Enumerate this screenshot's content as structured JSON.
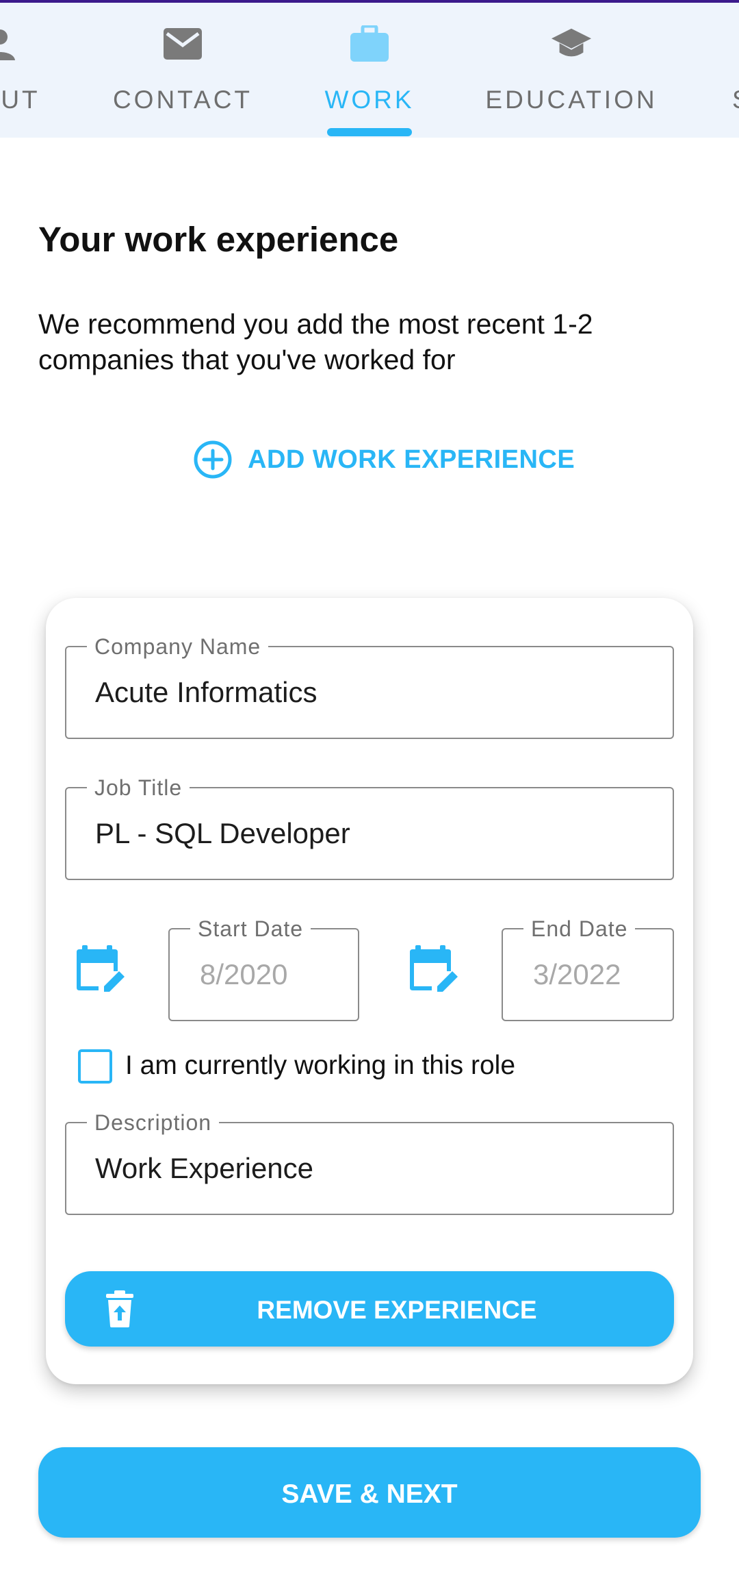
{
  "tabs": [
    {
      "label": "ABOUT",
      "visible_label": "UT",
      "icon": "person-icon",
      "active": false
    },
    {
      "label": "CONTACT",
      "icon": "envelope-icon",
      "active": false
    },
    {
      "label": "WORK",
      "icon": "briefcase-icon",
      "active": true
    },
    {
      "label": "EDUCATION",
      "icon": "graduation-cap-icon",
      "active": false
    },
    {
      "label": "S",
      "icon": "",
      "active": false
    }
  ],
  "page": {
    "title": "Your work experience",
    "subtitle": "We recommend you add the most recent 1-2 companies that you've worked for",
    "add_button": "ADD WORK EXPERIENCE"
  },
  "experience": {
    "company_label": "Company Name",
    "company_value": "Acute Informatics",
    "job_label": "Job Title",
    "job_value": "PL - SQL Developer",
    "start_label": "Start Date",
    "start_value": "8/2020",
    "end_label": "End Date",
    "end_value": "3/2022",
    "current_label": "I am currently working in this role",
    "current_checked": false,
    "description_label": "Description",
    "description_value": "Work Experience",
    "remove_button": "REMOVE EXPERIENCE"
  },
  "footer": {
    "save_button": "SAVE & NEXT"
  },
  "colors": {
    "accent": "#29b6f6",
    "tab_bar_bg": "#eef4fc",
    "inactive_tab": "#6e6e6e"
  }
}
